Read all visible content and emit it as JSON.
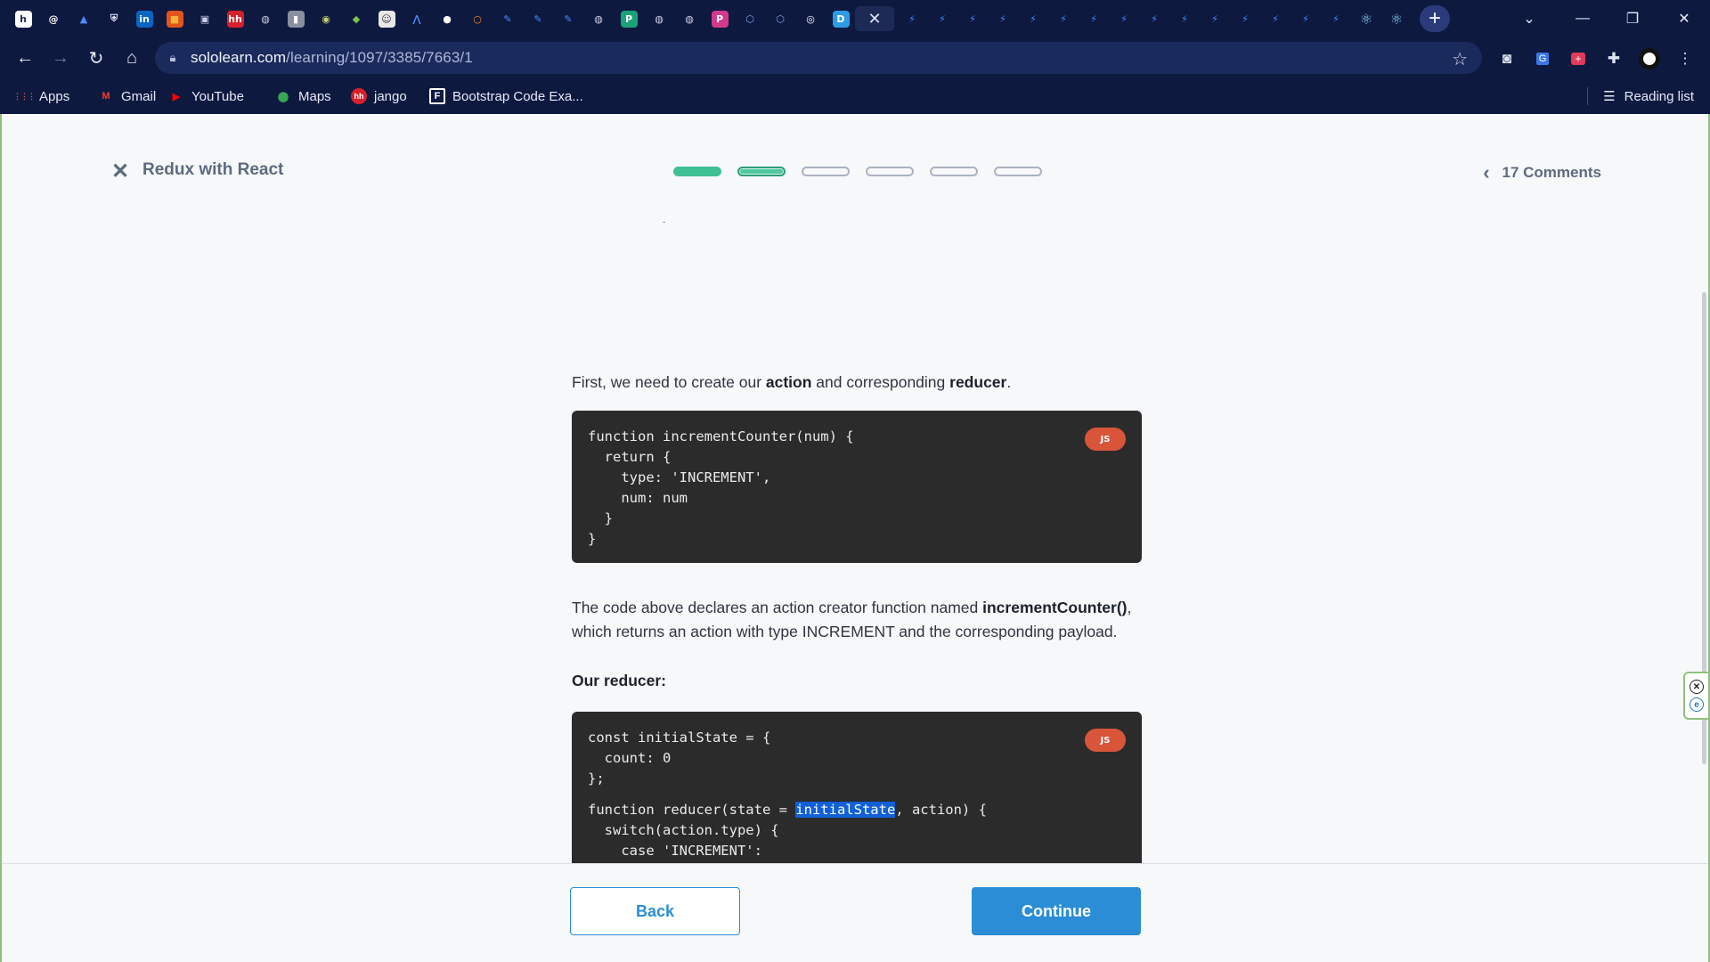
{
  "browser": {
    "tabs": [
      {
        "icon": "hashnode-icon",
        "glyph": "h",
        "bg": "#ffffff",
        "fg": "#1b2a5c"
      },
      {
        "icon": "at-sign-icon",
        "glyph": "@",
        "bg": "#0e1940",
        "fg": "#ffffff"
      },
      {
        "icon": "triangle-logo-icon",
        "glyph": "▲",
        "bg": "#0e1940",
        "fg": "#4a8bff"
      },
      {
        "icon": "shield-icon",
        "glyph": "⛨",
        "bg": "#0e1940",
        "fg": "#dfe3f2"
      },
      {
        "icon": "linkedin-icon",
        "glyph": "in",
        "bg": "#0a66c2",
        "fg": "#ffffff"
      },
      {
        "icon": "office-icon",
        "glyph": "■",
        "bg": "#e2541f",
        "fg": "#f6b23a"
      },
      {
        "icon": "monitor-icon",
        "glyph": "▣",
        "bg": "#0e1940",
        "fg": "#c9cfe6"
      },
      {
        "icon": "hh-icon",
        "glyph": "hh",
        "bg": "#d6202a",
        "fg": "#ffffff"
      },
      {
        "icon": "globe-icon",
        "glyph": "◍",
        "bg": "#0e1940",
        "fg": "#cfd4e8"
      },
      {
        "icon": "book-icon",
        "glyph": "▮",
        "bg": "#8a8f9f",
        "fg": "#ffffff"
      },
      {
        "icon": "chrome-web-icon",
        "glyph": "◉",
        "bg": "#0e1940",
        "fg": "#c7d06b"
      },
      {
        "icon": "cube-icon",
        "glyph": "◆",
        "bg": "#0e1940",
        "fg": "#7ec34a"
      },
      {
        "icon": "cartoon-icon",
        "glyph": "☺",
        "bg": "#e8e8e8",
        "fg": "#333333"
      },
      {
        "icon": "atlas-icon",
        "glyph": "⋀",
        "bg": "#0e1940",
        "fg": "#4a8bff"
      },
      {
        "icon": "github-icon",
        "glyph": "●",
        "bg": "#0e1940",
        "fg": "#ffffff"
      },
      {
        "icon": "ring-icon",
        "glyph": "○",
        "bg": "#0e1940",
        "fg": "#f28a24"
      },
      {
        "icon": "feather-icon",
        "glyph": "✎",
        "bg": "#0e1940",
        "fg": "#4a8bff"
      },
      {
        "icon": "feather-icon",
        "glyph": "✎",
        "bg": "#0e1940",
        "fg": "#4a8bff"
      },
      {
        "icon": "feather-icon",
        "glyph": "✎",
        "bg": "#0e1940",
        "fg": "#4a8bff"
      },
      {
        "icon": "globe-icon",
        "glyph": "◍",
        "bg": "#0e1940",
        "fg": "#cfd4e8"
      },
      {
        "icon": "p-logo-icon",
        "glyph": "P",
        "bg": "#1aa37a",
        "fg": "#ffffff"
      },
      {
        "icon": "globe-icon",
        "glyph": "◍",
        "bg": "#0e1940",
        "fg": "#cfd4e8"
      },
      {
        "icon": "globe-icon",
        "glyph": "◍",
        "bg": "#0e1940",
        "fg": "#cfd4e8"
      },
      {
        "icon": "p-logo-icon",
        "glyph": "P",
        "bg": "#d23a8c",
        "fg": "#ffffff"
      },
      {
        "icon": "hexagon-icon",
        "glyph": "⬡",
        "bg": "#0e1940",
        "fg": "#7fa2e8"
      },
      {
        "icon": "hexagon-icon",
        "glyph": "⬡",
        "bg": "#0e1940",
        "fg": "#7fa2e8"
      },
      {
        "icon": "circle-logo-icon",
        "glyph": "◎",
        "bg": "#0e1940",
        "fg": "#ffffff"
      },
      {
        "icon": "d-logo-icon",
        "glyph": "D",
        "bg": "#2d9be6",
        "fg": "#ffffff"
      }
    ],
    "active_tab_close": "✕",
    "tabs_after": [
      "bolt",
      "bolt",
      "bolt",
      "bolt",
      "bolt",
      "bolt",
      "bolt",
      "bolt",
      "bolt",
      "bolt",
      "bolt",
      "bolt",
      "bolt",
      "bolt",
      "bolt",
      "react",
      "react"
    ],
    "new_tab": "+",
    "address": {
      "host": "sololearn.com",
      "path": "/learning/1097/3385/7663/1"
    },
    "bookmarks": [
      {
        "label": "Apps",
        "icon": "apps-grid-icon",
        "glyph": "⋮⋮⋮",
        "color": "#e94b3c"
      },
      {
        "label": "Gmail",
        "icon": "gmail-icon",
        "glyph": "M",
        "color": "#ea4335"
      },
      {
        "label": "YouTube",
        "icon": "youtube-icon",
        "glyph": "▶",
        "color": "#ff0000"
      },
      {
        "label": "Maps",
        "icon": "maps-pin-icon",
        "glyph": "⬤",
        "color": "#34a853"
      },
      {
        "label": "jango",
        "icon": "hh-icon",
        "glyph": "hh",
        "color": "#d6202a"
      },
      {
        "label": "Bootstrap Code Exa...",
        "icon": "bootstrap-f-icon",
        "glyph": "F",
        "color": "#ffffff"
      }
    ],
    "reading_list": "Reading list"
  },
  "lesson": {
    "course_title": "Redux with React",
    "comments": "17 Comments",
    "progress_segments": [
      "done",
      "current",
      "todo",
      "todo",
      "todo",
      "todo"
    ],
    "intro_before": "First, we need to create our ",
    "intro_bold1": "action",
    "intro_middle": " and corresponding ",
    "intro_bold2": "reducer",
    "intro_after": ".",
    "code1": "function incrementCounter(num) {\n  return {\n    type: 'INCREMENT',\n    num: num\n  }\n}",
    "code_badge": "JS",
    "explain_before": "The code above declares an action creator function named ",
    "explain_bold": "incrementCounter()",
    "explain_after": ", which returns an action with type INCREMENT and the corresponding payload.",
    "reducer_heading": "Our reducer:",
    "code2_part1": "const initialState = {\n  count: 0\n};",
    "code2_line_prefix": "function reducer(state = ",
    "code2_highlight": "initialState",
    "code2_line_suffix": ", action) {",
    "code2_part2": "  switch(action.type) {\n    case 'INCREMENT':\n      return { count: state.count + action.num };\n    default:\n      return state;\n  }\n}",
    "back_label": "Back",
    "continue_label": "Continue"
  }
}
